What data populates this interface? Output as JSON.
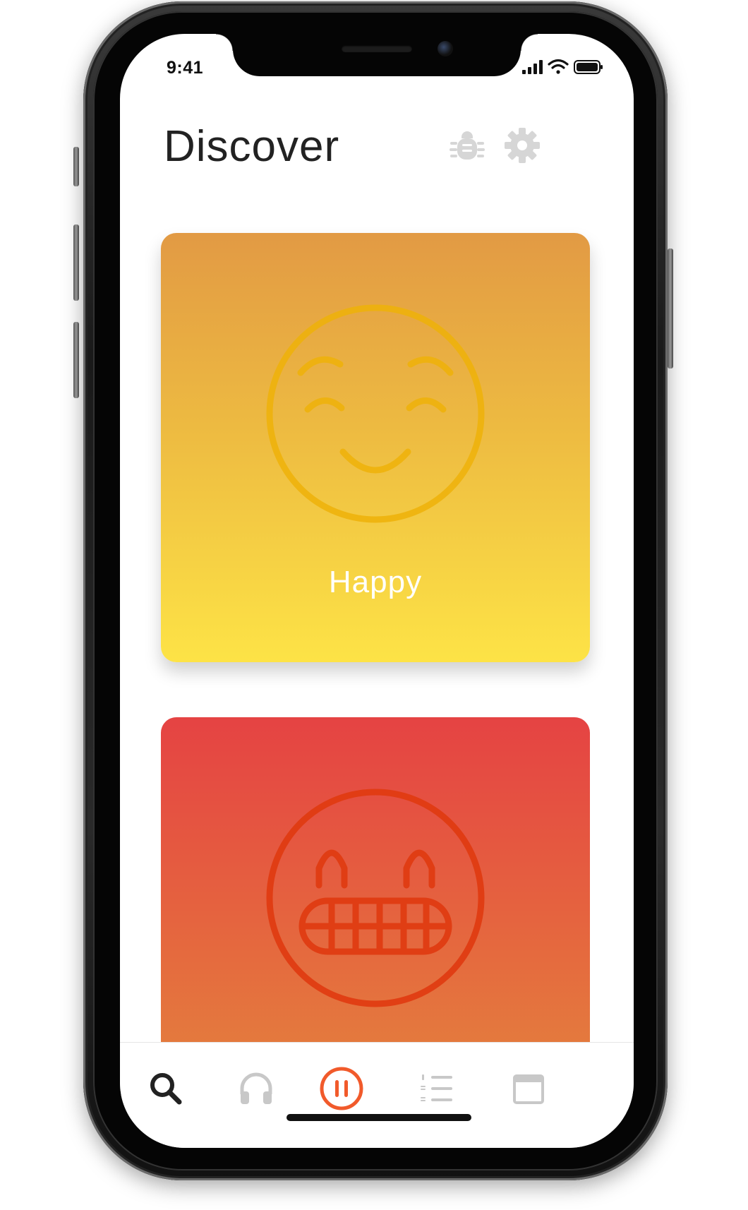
{
  "status_bar": {
    "time": "9:41"
  },
  "header": {
    "title": "Discover",
    "icons": [
      "bug-icon",
      "gear-icon"
    ]
  },
  "cards": [
    {
      "label": "Happy",
      "emoji": "smiling-face-icon",
      "gradient_top": "#E29A44",
      "gradient_bottom": "#FDE346",
      "emoji_color": "#F0B000"
    },
    {
      "label": "",
      "emoji": "grimacing-face-icon",
      "gradient_top": "#E54343",
      "gradient_bottom": "#E48A3C",
      "emoji_color": "#E04000"
    }
  ],
  "tabbar": {
    "tabs": [
      {
        "icon": "search-icon",
        "active": true
      },
      {
        "icon": "headphones-icon",
        "active": false
      },
      {
        "icon": "pause-icon",
        "active": true,
        "accent": "#F15A2B"
      },
      {
        "icon": "numbered-list-icon",
        "active": false
      },
      {
        "icon": "calendar-icon",
        "active": false
      }
    ]
  },
  "colors": {
    "accent": "#F15A2B",
    "inactive_icon": "#C8C8C8",
    "title_text": "#222222"
  }
}
